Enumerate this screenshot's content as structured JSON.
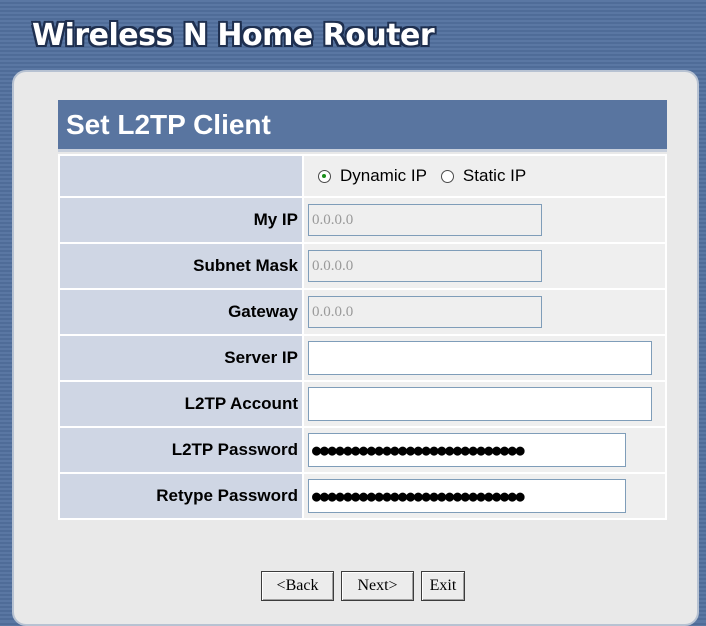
{
  "app": {
    "title": "Wireless N Home Router"
  },
  "section": {
    "title": "Set L2TP Client"
  },
  "form": {
    "mode": {
      "selected": "Dynamic IP",
      "options": [
        "Dynamic IP",
        "Static IP"
      ]
    },
    "fields": {
      "my_ip": {
        "label": "My IP",
        "value": "0.0.0.0"
      },
      "subnet_mask": {
        "label": "Subnet Mask",
        "value": "0.0.0.0"
      },
      "gateway": {
        "label": "Gateway",
        "value": "0.0.0.0"
      },
      "server_ip": {
        "label": "Server IP",
        "value": ""
      },
      "l2tp_account": {
        "label": "L2TP Account",
        "value": ""
      },
      "l2tp_password": {
        "label": "L2TP Password",
        "value": "●●●●●●●●●●●●●●●●●●●●●●●●●●●"
      },
      "retype_password": {
        "label": "Retype Password",
        "value": "●●●●●●●●●●●●●●●●●●●●●●●●●●●"
      }
    }
  },
  "buttons": {
    "back": "<Back",
    "next": "Next>",
    "exit": "Exit"
  },
  "colors": {
    "background": "#5a77a3",
    "header": "#5975a0",
    "label_cell": "#cfd6e4",
    "radio_dot": "#1a8f1a"
  }
}
